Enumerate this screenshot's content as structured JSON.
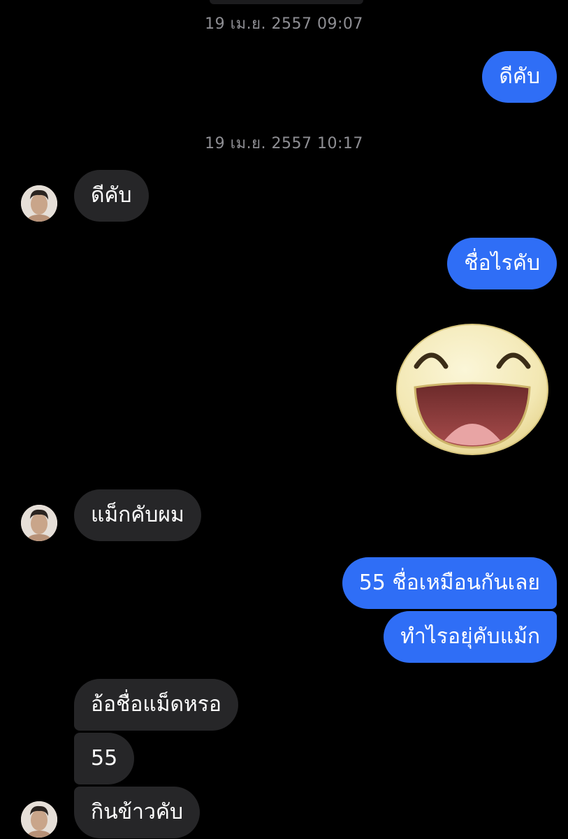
{
  "timestamps": [
    "19 เม.ย. 2557 09:07",
    "19 เม.ย. 2557 10:17"
  ],
  "messages": {
    "m1": "ดีคับ",
    "m2": "ดีคับ",
    "m3": "ชื่อไรคับ",
    "m4": "แม็กคับผม",
    "m5": "55 ชื่อเหมือนกันเลย",
    "m6": "ทำไรอยุ่คับแม้ก",
    "m7": "อ้อชื่อแม็ดหรอ",
    "m8": "55",
    "m9": "กินข้าวคับ"
  },
  "sticker": "laughing-face-sticker",
  "colors": {
    "background": "#000000",
    "outgoing_bubble": "#2f6ef6",
    "incoming_bubble": "#262628",
    "timestamp_text": "#8e8e93"
  }
}
